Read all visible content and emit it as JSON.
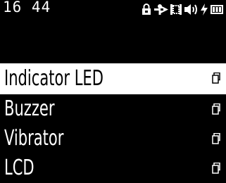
{
  "status_bar": {
    "time": "16 44",
    "icons": [
      "lock-icon",
      "usb-icon",
      "sim-icon",
      "volume-icon",
      "flash-icon",
      "battery-icon"
    ]
  },
  "menu": {
    "items": [
      {
        "label": "Indicator LED",
        "selected": true
      },
      {
        "label": "Buzzer",
        "selected": false
      },
      {
        "label": "Vibrator",
        "selected": false
      },
      {
        "label": "LCD",
        "selected": false
      }
    ],
    "item_icon": "document-icon"
  }
}
